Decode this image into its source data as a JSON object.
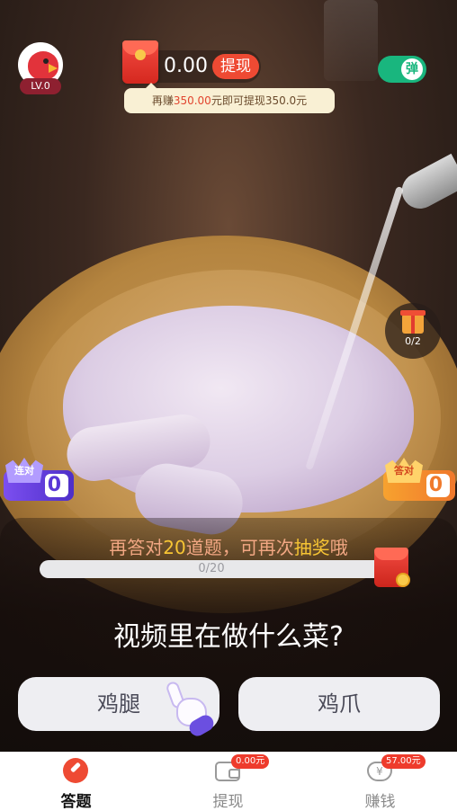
{
  "user": {
    "level": "LV.0"
  },
  "wallet": {
    "amount": "0.00",
    "withdraw_label": "提现"
  },
  "tip": {
    "prefix": "再赚",
    "highlight": "350.00",
    "suffix": "元即可提现350.0元"
  },
  "toggle": {
    "label": "弹",
    "state": "on"
  },
  "gift": {
    "count": "0/2"
  },
  "streak": {
    "left": {
      "label": "连对",
      "value": "0"
    },
    "right": {
      "label": "答对",
      "value": "0"
    }
  },
  "lottery": {
    "part1": "再答对",
    "count": "20",
    "part2": "道题，可再次",
    "highlight": "抽奖",
    "part3": "哦"
  },
  "progress": {
    "text": "0/20",
    "fraction": 0
  },
  "question": {
    "text": "视频里在做什么菜?"
  },
  "options": [
    {
      "label": "鸡腿"
    },
    {
      "label": "鸡爪"
    }
  ],
  "nav": {
    "items": [
      {
        "label": "答题",
        "active": true
      },
      {
        "label": "提现",
        "badge": "0.00元"
      },
      {
        "label": "赚钱",
        "badge": "57.00元"
      }
    ]
  },
  "colors": {
    "accent": "#ee4a33",
    "toggle": "#19b67e",
    "lottery_highlight": "#f7c534"
  }
}
